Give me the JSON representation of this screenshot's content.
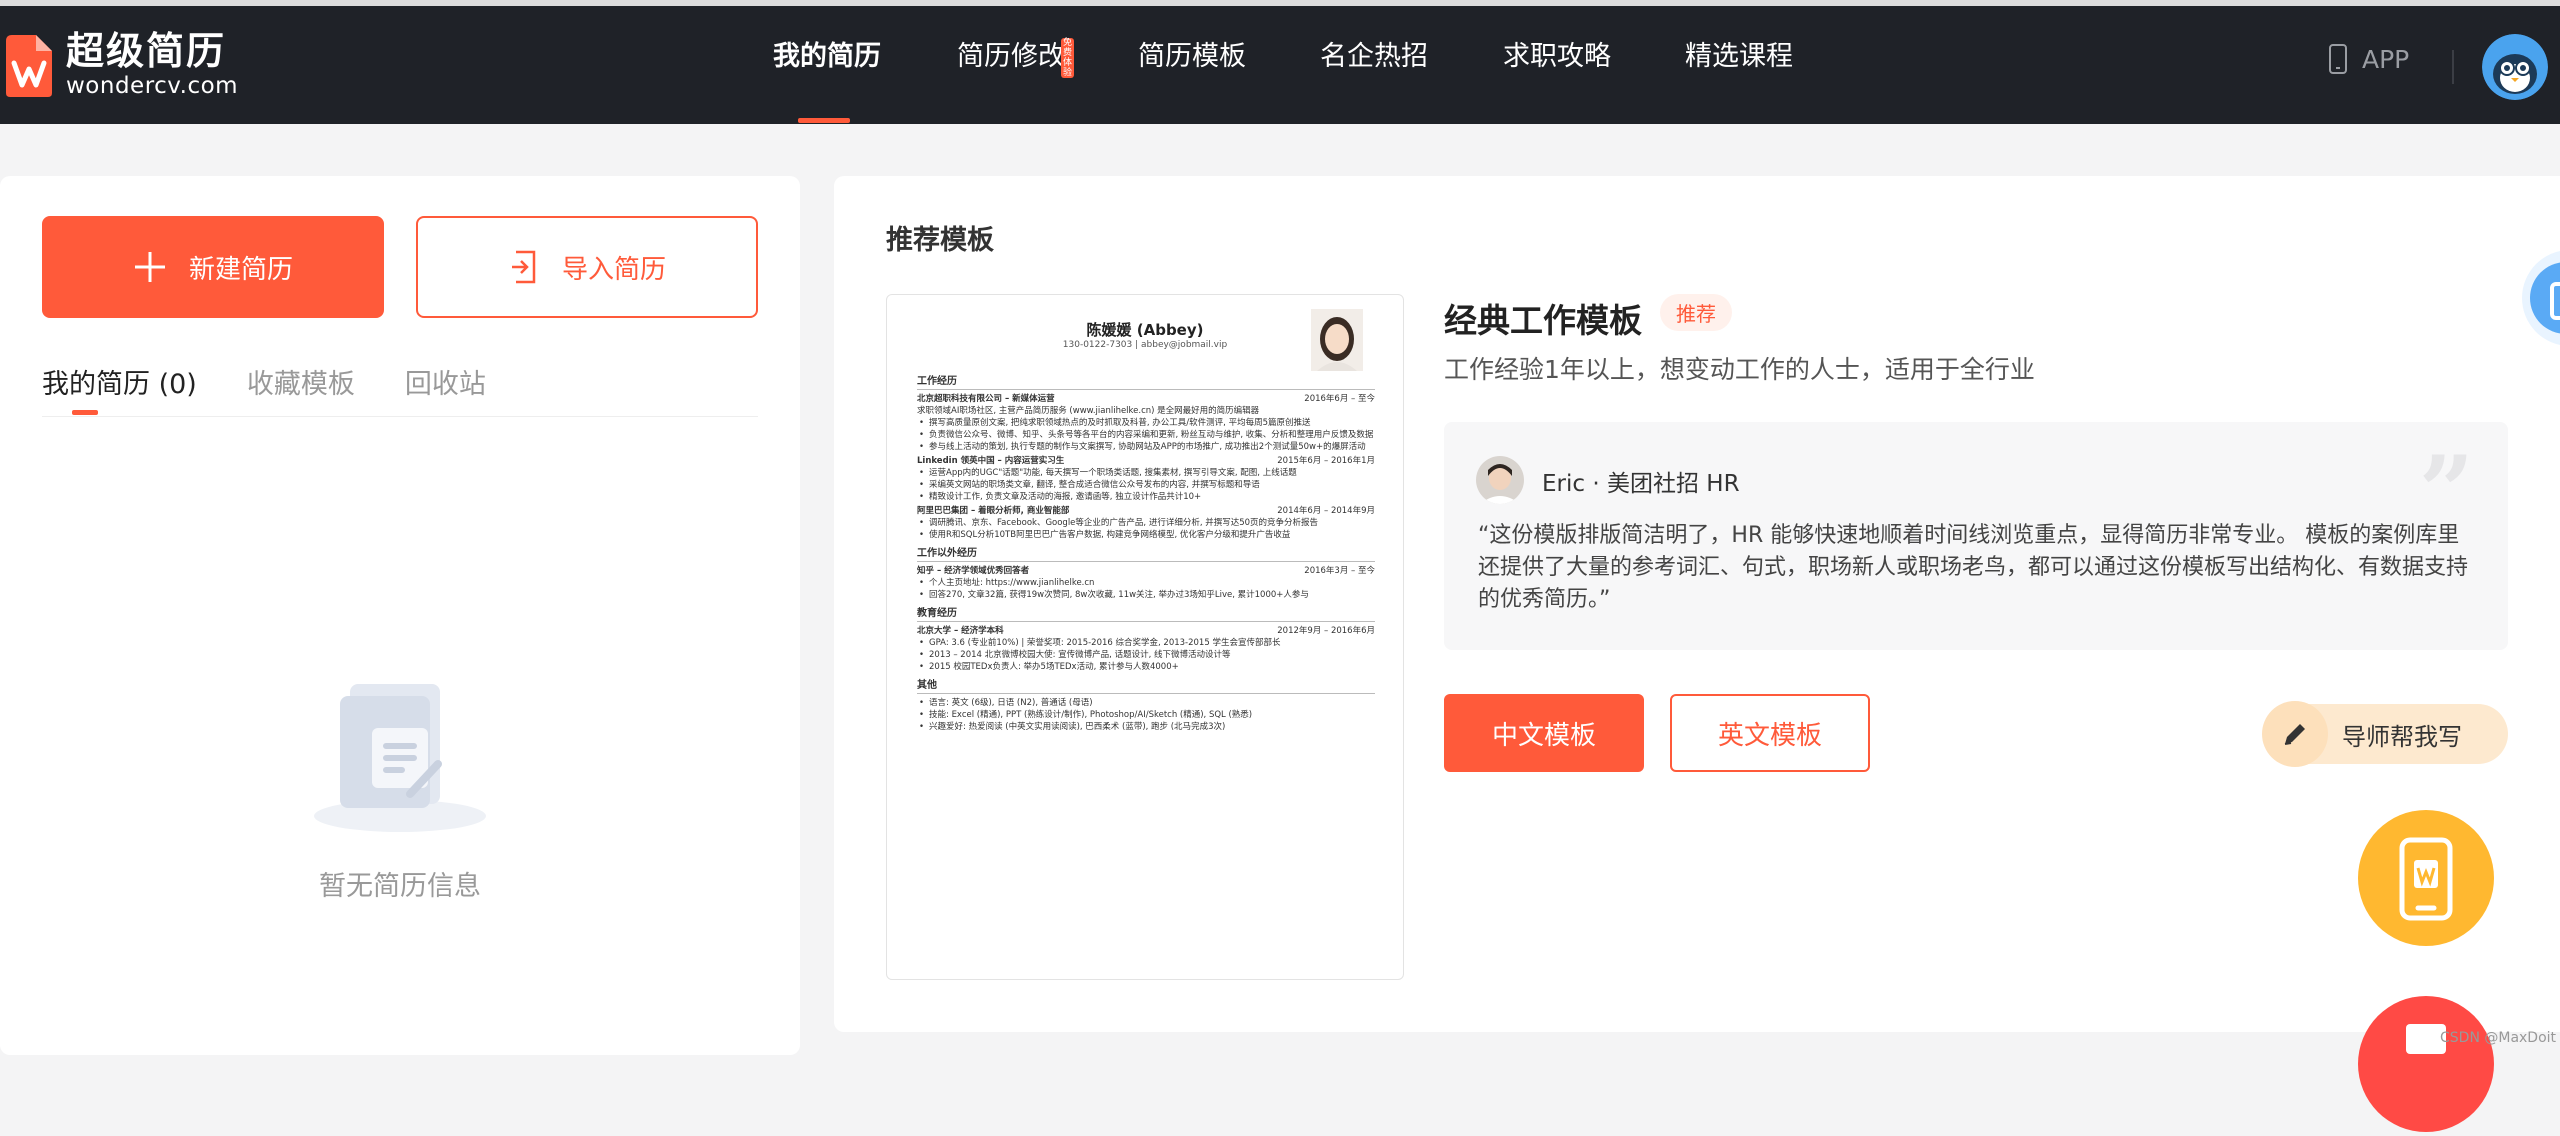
{
  "brand": {
    "name": "超级简历",
    "domain": "wondercv.com",
    "accent_color": "#ff5a3a",
    "header_bg": "#1f2228"
  },
  "nav": {
    "items": [
      {
        "label": "我的简历",
        "active": true
      },
      {
        "label": "简历修改",
        "badge": "免费体验"
      },
      {
        "label": "简历模板"
      },
      {
        "label": "名企热招"
      },
      {
        "label": "求职攻略"
      },
      {
        "label": "精选课程"
      }
    ],
    "app_label": "APP"
  },
  "left": {
    "new_button": "新建简历",
    "import_button": "导入简历",
    "tabs": [
      "我的简历 (0)",
      "收藏模板",
      "回收站"
    ],
    "empty_text": "暂无简历信息"
  },
  "main": {
    "section_title": "推荐模板",
    "template_title": "经典工作模板",
    "badge": "推荐",
    "description": "工作经验1年以上，想变动工作的人士，适用于全行业",
    "review": {
      "author": "Eric · 美团社招 HR",
      "text": "“这份模版排版简洁明了，HR 能够快速地顺着时间线浏览重点，显得简历非常专业。 模板的案例库里还提供了大量的参考词汇、句式，职场新人或职场老鸟，都可以通过这份模板写出结构化、有数据支持的优秀简历。”"
    },
    "cn_button": "中文模板",
    "en_button": "英文模板",
    "mentor_button": "导师帮我写"
  },
  "resume_preview": {
    "name": "陈媛媛 (Abbey)",
    "contact": "130-0122-7303 | abbey@jobmail.vip",
    "sections": [
      {
        "title": "工作经历",
        "entries": [
          {
            "org": "北京超职科技有限公司 – 新媒体运营",
            "date": "2016年6月 – 至今",
            "lines": [
              "求职领域AI职场社区, 主营产品简历服务 (www.jianlihelke.cn) 是全网最好用的简历编辑器",
              "撰写高质量原创文案, 把纯求职领域热点的及时抓取及科普, 办公工具/软件测评, 平均每周5篇原创推送",
              "负责微信公众号、微博、知乎、头条号等各平台的内容采编和更新, 粉丝互动与维护, 收集、分析和整理用户反馈及数据",
              "参与线上活动的策划, 执行专题的制作与文案撰写, 协助网站及APP的市场推广, 成功推出2个测试量50w+的爆屏活动"
            ]
          },
          {
            "org": "Linkedin 领英中国 – 内容运营实习生",
            "date": "2015年6月 – 2016年1月",
            "lines": [
              "运营App内的UGC\"话题\"功能, 每天撰写一个职场类话题, 搜集素材, 撰写引导文案, 配图, 上线话题",
              "采编英文网站的职场类文章, 翻译, 整合成适合微信公众号发布的内容, 并撰写标题和导语",
              "精致设计工作, 负责文章及活动的海报, 邀请函等, 独立设计作品共计10+"
            ]
          },
          {
            "org": "阿里巴巴集团 – 着眼分析师, 商业智能部",
            "date": "2014年6月 – 2014年9月",
            "lines": [
              "调研腾讯、京东、Facebook、Google等企业的广告产品, 进行详细分析, 并撰写达50页的竞争分析报告",
              "使用R和SQL分析10TB阿里巴巴广告客户数据, 构建竞争网络模型, 优化客户分级和提升广告收益"
            ]
          }
        ]
      },
      {
        "title": "工作以外经历",
        "entries": [
          {
            "org": "知乎 – 经济学领域优秀回答者",
            "date": "2016年3月 – 至今",
            "lines": [
              "个人主页地址: https://www.jianlihelke.cn",
              "回答270, 文章32篇, 获得19w次赞同, 8w次收藏, 11w关注, 举办过3场知乎Live, 累计1000+人参与"
            ]
          }
        ]
      },
      {
        "title": "教育经历",
        "entries": [
          {
            "org": "北京大学 – 经济学本科",
            "date": "2012年9月 – 2016年6月",
            "lines": [
              "GPA: 3.6 (专业前10%) | 荣誉奖项: 2015-2016 综合奖学金, 2013-2015 学生会宣传部部长",
              "2013 – 2014 北京微博校园大使: 宣传微博产品, 话题设计, 线下微博活动设计等",
              "2015 校园TEDx负责人: 举办5场TEDx活动, 累计参与人数4000+"
            ]
          }
        ]
      },
      {
        "title": "其他",
        "entries": [
          {
            "org": "",
            "date": "",
            "lines": [
              "语言: 英文 (6级), 日语 (N2), 普通话 (母语)",
              "技能: Excel (精通), PPT (熟练设计/制作), Photoshop/AI/Sketch (精通), SQL (熟悉)",
              "兴趣爱好: 热爱阅读 (中英文实用读阅读), 巴西柔术 (蓝带), 跑步 (北马完成3次)"
            ]
          }
        ]
      }
    ]
  },
  "watermark": "CSDN @MaxDoit"
}
